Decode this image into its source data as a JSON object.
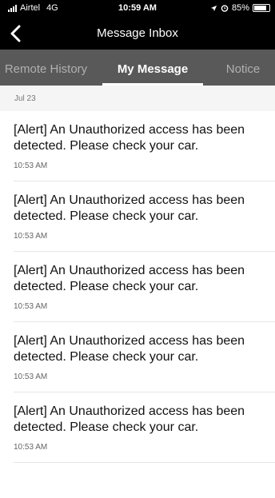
{
  "status_bar": {
    "carrier": "Airtel",
    "network": "4G",
    "time": "10:59 AM",
    "battery": "85%",
    "battery_level": 0.85
  },
  "header": {
    "title": "Message Inbox",
    "back_icon": "chevron-left-icon"
  },
  "tabs": [
    {
      "label": "Remote History",
      "active": false
    },
    {
      "label": "My Message",
      "active": true
    },
    {
      "label": "Notice",
      "active": false
    }
  ],
  "date_group": "Jul 23",
  "messages": [
    {
      "text": "[Alert] An Unauthorized access has been detected. Please check your car.",
      "time": "10:53 AM"
    },
    {
      "text": "[Alert] An Unauthorized access has been detected. Please check your car.",
      "time": "10:53 AM"
    },
    {
      "text": "[Alert] An Unauthorized access has been detected. Please check your car.",
      "time": "10:53 AM"
    },
    {
      "text": "[Alert] An Unauthorized access has been detected. Please check your car.",
      "time": "10:53 AM"
    },
    {
      "text": "[Alert] An Unauthorized access has been detected. Please check your car.",
      "time": "10:53 AM"
    }
  ],
  "colors": {
    "header_bg": "#000000",
    "tabs_bg": "#595959",
    "active_tab": "#ffffff",
    "inactive_tab": "#b0b0b0"
  }
}
